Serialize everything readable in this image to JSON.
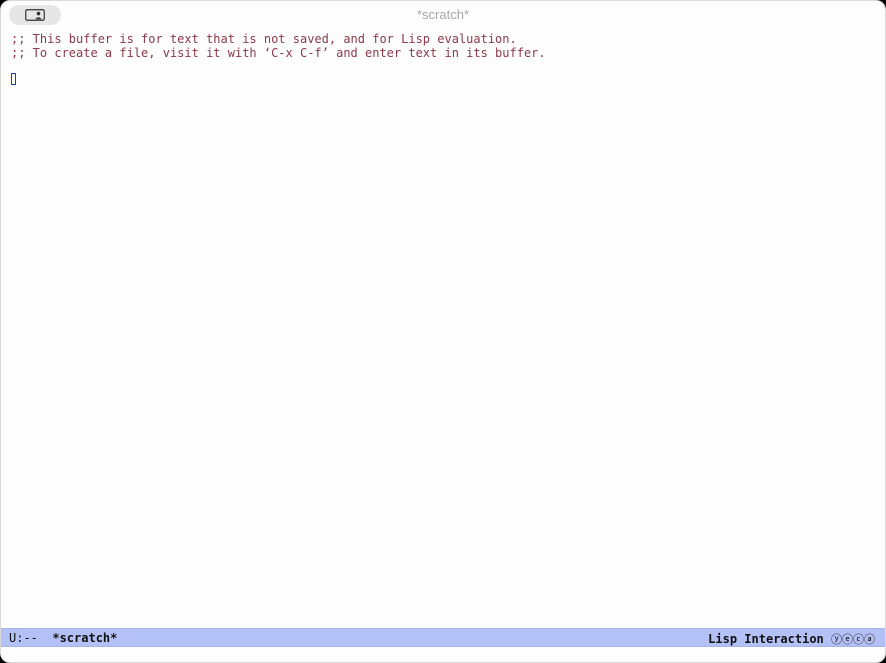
{
  "window": {
    "title": "*scratch*"
  },
  "buffer": {
    "lines": [
      ";; This buffer is for text that is not saved, and for Lisp evaluation.",
      ";; To create a file, visit it with ‘C-x C-f’ and enter text in its buffer."
    ]
  },
  "modeline": {
    "status": "U:--",
    "buffer_name": "*scratch*",
    "mode": "Lisp Interaction",
    "minor_icons": "ⓨⓔⓒⓐ"
  },
  "colors": {
    "comment_text": "#8b3a4a",
    "modeline_bg": "#b4c1f6",
    "cursor": "#1f3fa6"
  },
  "icons": {
    "titlebar_button": "sidebar-person-icon"
  }
}
